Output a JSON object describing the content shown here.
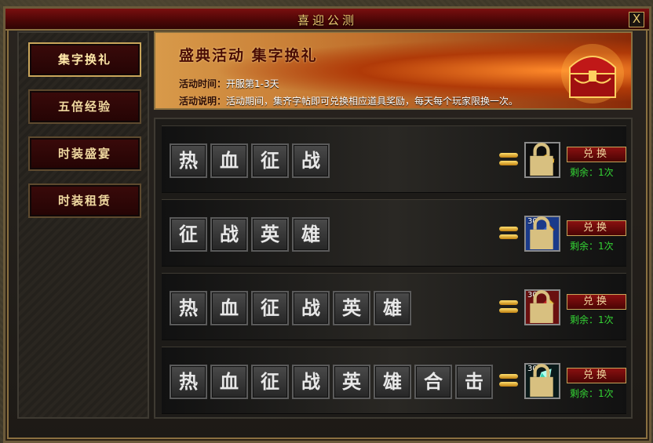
{
  "window": {
    "title": "喜迎公测",
    "close_label": "X"
  },
  "sidebar": {
    "items": [
      {
        "label": "集字换礼",
        "active": true
      },
      {
        "label": "五倍经验",
        "active": false
      },
      {
        "label": "时装盛宴",
        "active": false
      },
      {
        "label": "时装租赁",
        "active": false
      }
    ]
  },
  "banner": {
    "title": "盛典活动 集字换礼",
    "time_key": "活动时间：",
    "time_value": "开服第1-3天",
    "desc_key": "活动说明：",
    "desc_value": "活动期间，集齐字帖即可兑换相应道具奖励，每天每个玩家限换一次。",
    "icon": "treasure-chest-icon"
  },
  "rewards": [
    {
      "chars": [
        "热",
        "血",
        "征",
        "战"
      ],
      "item_icon": "gold-bar-icon",
      "item_count": "",
      "button": "兑换",
      "remaining": "剩余：1次"
    },
    {
      "chars": [
        "征",
        "战",
        "英",
        "雄"
      ],
      "item_icon": "blue-scroll-icon",
      "item_count": "30",
      "button": "兑换",
      "remaining": "剩余：1次"
    },
    {
      "chars": [
        "热",
        "血",
        "征",
        "战",
        "英",
        "雄"
      ],
      "item_icon": "red-scroll-icon",
      "item_count": "30",
      "button": "兑换",
      "remaining": "剩余：1次"
    },
    {
      "chars": [
        "热",
        "血",
        "征",
        "战",
        "英",
        "雄",
        "合",
        "击"
      ],
      "item_icon": "green-crystal-icon",
      "item_count": "30",
      "button": "兑换",
      "remaining": "剩余：1次"
    }
  ],
  "colors": {
    "accent_gold": "#c9a55a",
    "title_red": "#7a0f0f",
    "remaining_green": "#34d434"
  }
}
